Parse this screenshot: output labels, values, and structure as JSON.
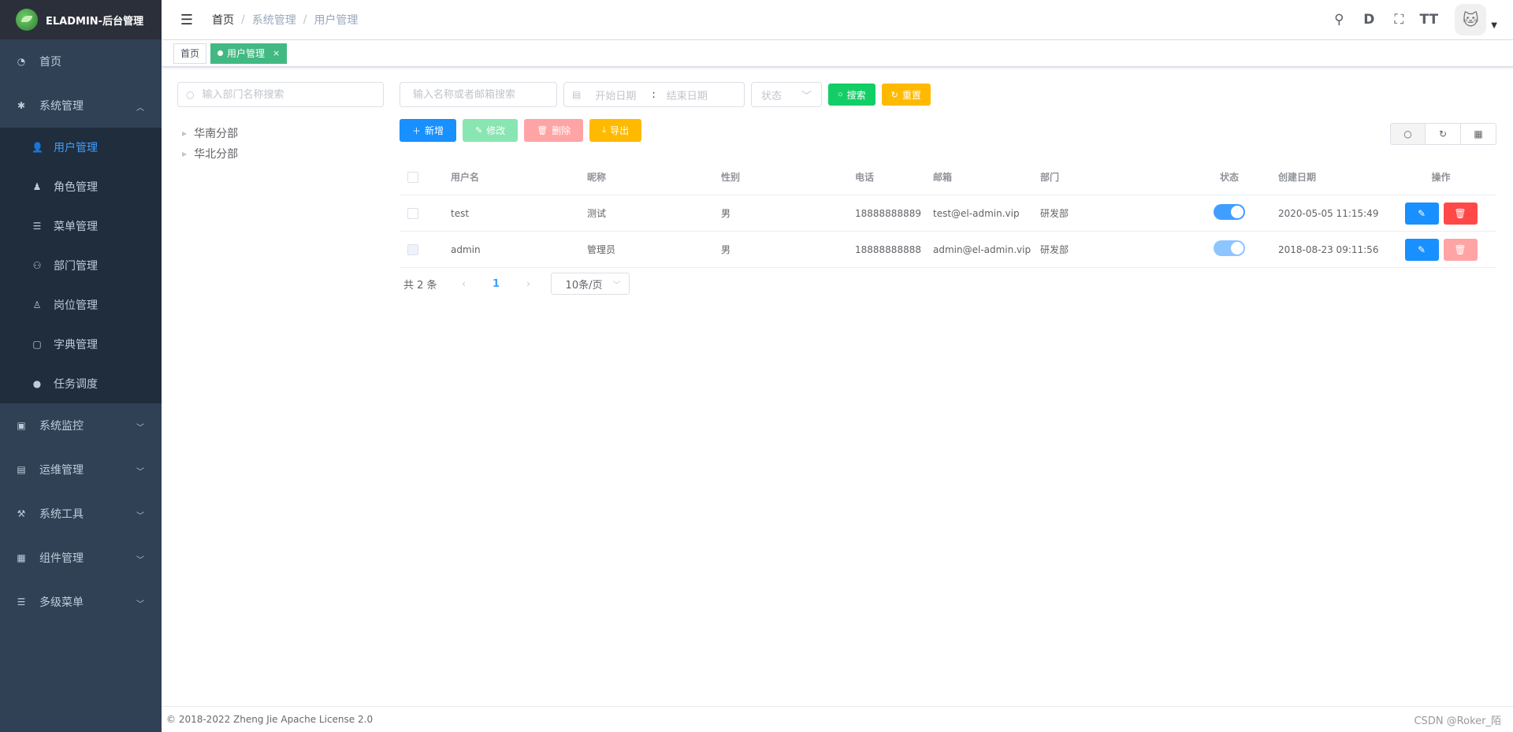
{
  "app": {
    "title": "ELADMIN-后台管理"
  },
  "sidebar": {
    "items": [
      {
        "label": "首页",
        "icon": "dashboard-icon"
      },
      {
        "label": "系统管理",
        "icon": "gear-icon",
        "expanded": true,
        "children": [
          {
            "label": "用户管理",
            "icon": "user-icon",
            "active": true
          },
          {
            "label": "角色管理",
            "icon": "role-icon"
          },
          {
            "label": "菜单管理",
            "icon": "menu-icon"
          },
          {
            "label": "部门管理",
            "icon": "dept-icon"
          },
          {
            "label": "岗位管理",
            "icon": "position-icon"
          },
          {
            "label": "字典管理",
            "icon": "dictionary-icon"
          },
          {
            "label": "任务调度",
            "icon": "clock-icon"
          }
        ]
      },
      {
        "label": "系统监控",
        "icon": "monitor-icon"
      },
      {
        "label": "运维管理",
        "icon": "ops-icon"
      },
      {
        "label": "系统工具",
        "icon": "tools-icon"
      },
      {
        "label": "组件管理",
        "icon": "components-icon"
      },
      {
        "label": "多级菜单",
        "icon": "list-icon"
      }
    ]
  },
  "navbar": {
    "breadcrumb": [
      "首页",
      "系统管理",
      "用户管理"
    ],
    "separator": "/"
  },
  "tags": [
    {
      "label": "首页",
      "active": false
    },
    {
      "label": "用户管理",
      "active": true,
      "close": "×"
    }
  ],
  "dept": {
    "search_placeholder": "输入部门名称搜索",
    "tree": [
      "华南分部",
      "华北分部"
    ]
  },
  "filters": {
    "keyword_placeholder": "输入名称或者邮箱搜索",
    "start_placeholder": "开始日期",
    "range_separator": ":",
    "end_placeholder": "结束日期",
    "status_placeholder": "状态",
    "search_label": "搜索",
    "reset_label": "重置"
  },
  "crud": {
    "add_label": "新增",
    "edit_label": "修改",
    "delete_label": "删除",
    "export_label": "导出"
  },
  "table": {
    "columns": [
      "用户名",
      "昵称",
      "性别",
      "电话",
      "邮箱",
      "部门",
      "状态",
      "创建日期",
      "操作"
    ],
    "rows": [
      {
        "username": "test",
        "nickname": "测试",
        "gender": "男",
        "phone": "18888888889",
        "email": "test@el-admin.vip",
        "dept": "研发部",
        "enabled": true,
        "created": "2020-05-05 11:15:49",
        "deletable": true
      },
      {
        "username": "admin",
        "nickname": "管理员",
        "gender": "男",
        "phone": "18888888888",
        "email": "admin@el-admin.vip",
        "dept": "研发部",
        "enabled": true,
        "created": "2018-08-23 09:11:56",
        "deletable": false
      }
    ]
  },
  "pagination": {
    "total_text": "共 2 条",
    "current_page": "1",
    "page_size": "10条/页"
  },
  "footer": {
    "copyright": "© 2018-2022 Zheng Jie Apache License 2.0",
    "credit": "CSDN @Roker_陌"
  },
  "colors": {
    "sidebar_bg": "#304156",
    "submenu_bg": "#1f2d3d",
    "active_text": "#409eff",
    "tag_active": "#42b983",
    "success": "#13ce66",
    "warning": "#ffba00",
    "primary": "#1890ff",
    "danger": "#ff4949"
  }
}
